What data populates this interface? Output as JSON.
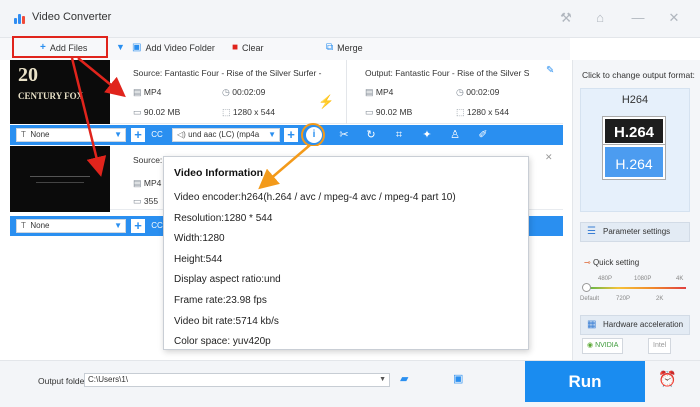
{
  "app": {
    "title": "Video Converter",
    "window_buttons": [
      "⚒",
      "⌂",
      "—",
      "✕"
    ]
  },
  "toolbar": {
    "add_files": "Add Files",
    "add_video_folder": "Add Video Folder",
    "clear": "Clear",
    "merge": "Merge"
  },
  "files": [
    {
      "source": "Source: Fantastic Four - Rise of the Silver Surfer -",
      "format": "MP4",
      "duration": "00:02:09",
      "size": "90.02 MB",
      "resolution": "1280 x 544",
      "output": "Output: Fantastic Four - Rise of the Silver S",
      "out_format": "MP4",
      "out_duration": "00:02:09",
      "out_size": "90.02 MB",
      "out_resolution": "1280 x 544",
      "subtitle": "None",
      "audio": "und aac (LC) (mp4a"
    },
    {
      "source": "Source: C",
      "format": "MP4",
      "size": "355",
      "subtitle": "None"
    }
  ],
  "popup": {
    "title": "Video Information",
    "rows": [
      "Video encoder:h264(h.264 / avc / mpeg-4 avc / mpeg-4 part 10)",
      "Resolution:1280 * 544",
      "Width:1280",
      "Height:544",
      "Display aspect ratio:und",
      "Frame rate:23.98 fps",
      "Video bit rate:5714 kb/s",
      "Color space: yuv420p"
    ]
  },
  "right_panel": {
    "title": "Click to change output format:",
    "format_name": "H264",
    "badge_top": "H.264",
    "badge_bottom": "H.264",
    "parameter_settings": "Parameter settings",
    "quick_setting": "Quick setting",
    "ticks_top": [
      "480P",
      "1080P",
      "4K"
    ],
    "ticks_bottom": [
      "Default",
      "720P",
      "2K"
    ],
    "slider_level": 0,
    "hardware_acceleration": "Hardware acceleration",
    "nvidia": "NVIDIA",
    "intel": "Intel"
  },
  "bottom": {
    "output_folder_label": "Output folder:",
    "output_folder_value": "C:\\Users\\1\\",
    "run": "Run"
  },
  "colors": {
    "accent": "#2a8ff0",
    "run": "#1a8cf0",
    "highlight_red": "#e0241c",
    "highlight_orange": "#f39a1a"
  },
  "thumbnail_logo": "20\nCENTURY\nFOX"
}
